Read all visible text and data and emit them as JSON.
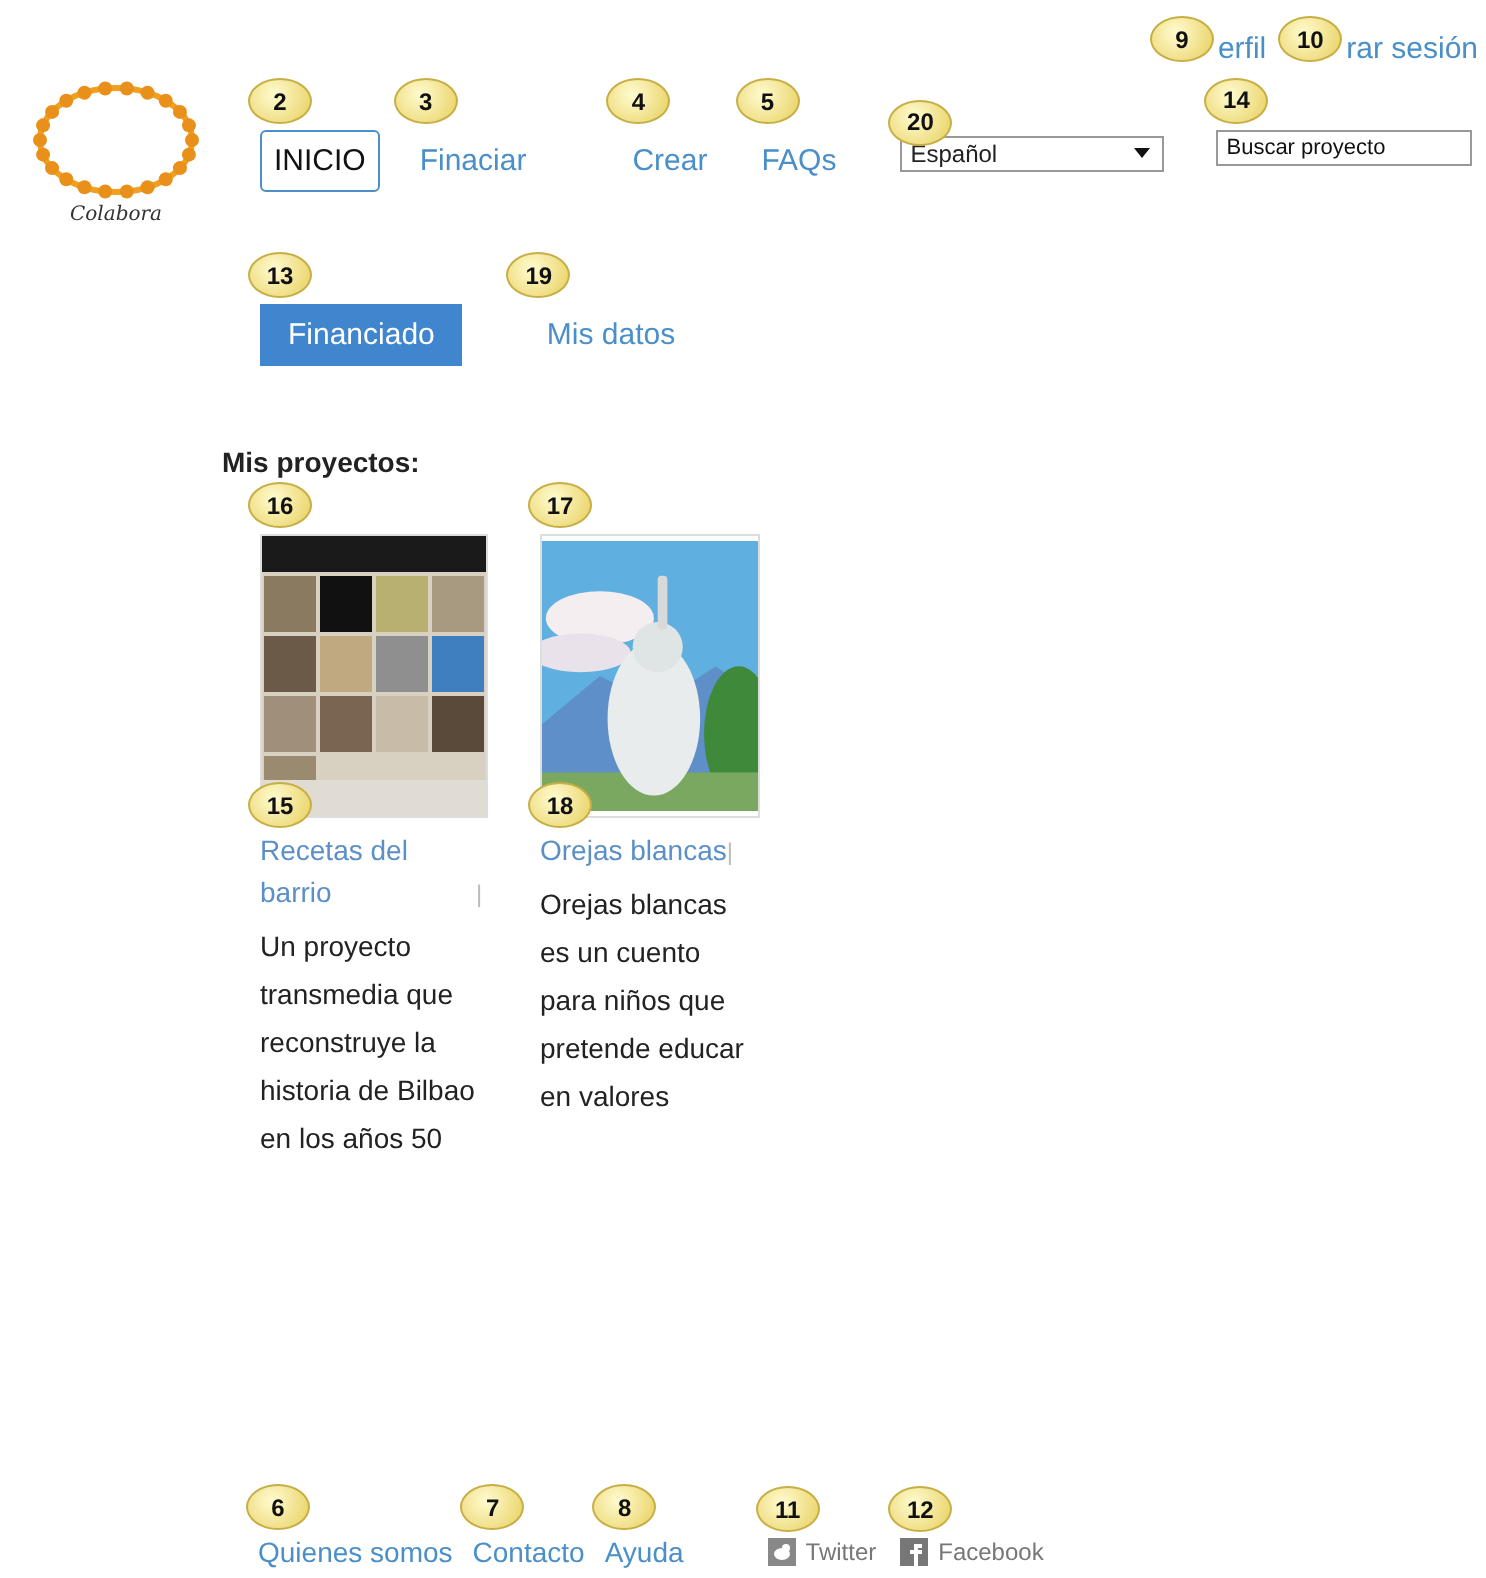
{
  "logo": {
    "text": "Colabora"
  },
  "account_links": [
    {
      "label": "erfil",
      "callout": "9"
    },
    {
      "label": "rar sesión",
      "callout": "10"
    }
  ],
  "nav": [
    {
      "label": "INICIO",
      "selected": true,
      "callout": "2"
    },
    {
      "label": "Finaciar",
      "selected": false,
      "callout": "3"
    },
    {
      "label": "Crear",
      "selected": false,
      "callout": "4"
    },
    {
      "label": "FAQs",
      "selected": false,
      "callout": "5"
    }
  ],
  "language": {
    "value": "Español",
    "callout": "20"
  },
  "search": {
    "placeholder": "Buscar proyecto",
    "callout": "14"
  },
  "tabs": [
    {
      "label": "Financiado",
      "selected": true,
      "callout": "13"
    },
    {
      "label": "Mis datos",
      "selected": false,
      "callout": "19"
    }
  ],
  "section_title": "Mis proyectos:",
  "projects": [
    {
      "image_callout": "16",
      "title_callout": "15",
      "title": "Recetas del barrio",
      "separator": "|",
      "description": "Un proyecto transmedia que reconstruye la historia de Bilbao en los años 50"
    },
    {
      "image_callout": "17",
      "title_callout": "18",
      "title": "Orejas blancas",
      "separator": "|",
      "description": "Orejas blancas es un cuento para niños que pretende educar en valores"
    }
  ],
  "footer": {
    "links": [
      {
        "label": "Quienes somos",
        "callout": "6"
      },
      {
        "label": "Contacto",
        "callout": "7"
      },
      {
        "label": "Ayuda",
        "callout": "8"
      }
    ],
    "social": [
      {
        "kind": "twitter",
        "label": "Twitter",
        "callout": "11"
      },
      {
        "kind": "facebook",
        "label": "Facebook",
        "callout": "12"
      }
    ]
  }
}
